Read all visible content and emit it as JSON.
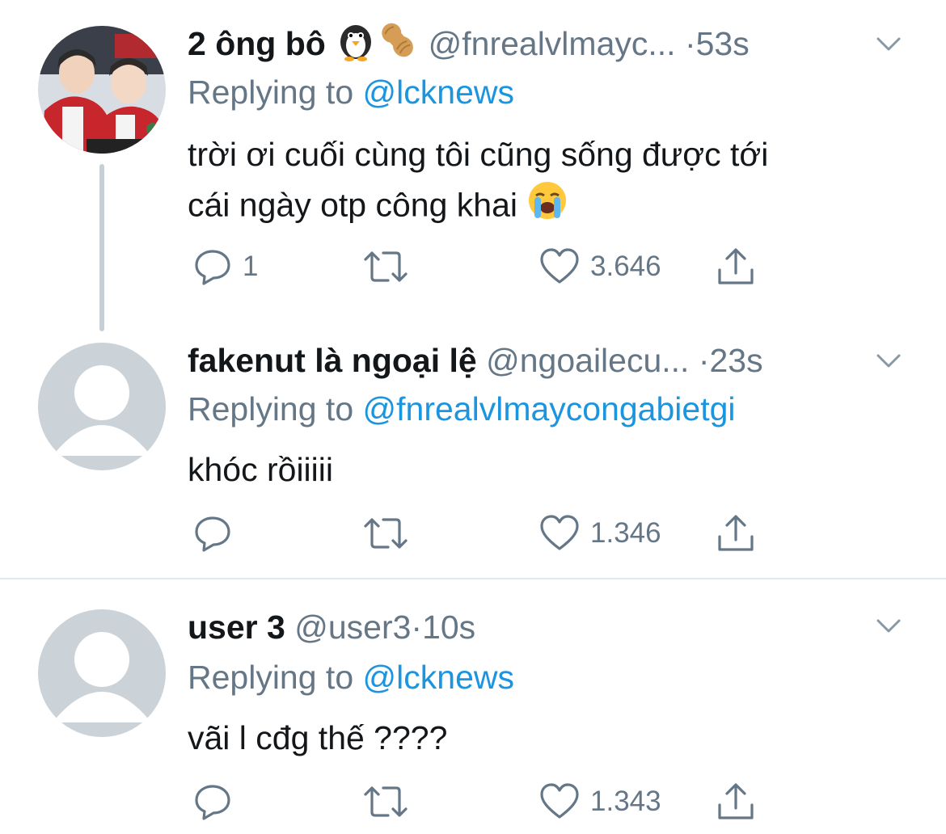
{
  "tweets": [
    {
      "name": "2 ông bô",
      "emojis": [
        "penguin-emoji",
        "peanut-emoji"
      ],
      "handle": "@fnrealvlmayc...",
      "time": "53s",
      "replying_label": "Replying to",
      "replying_handle": "@lcknews",
      "text_lines": [
        "trời ơi cuối cùng tôi cũng sống được tới",
        "cái ngày otp công khai"
      ],
      "text_emoji": "loudly-crying-face-emoji",
      "actions": {
        "reply_count": "1",
        "retweet_count": "",
        "like_count": "3.646"
      },
      "avatar": "photo"
    },
    {
      "name": "fakenut là ngoại lệ",
      "handle": "@ngoailecu...",
      "time": "23s",
      "replying_label": "Replying to",
      "replying_handle": "@fnrealvlmaycongabietgi",
      "text_lines": [
        "khóc rồiiiii"
      ],
      "actions": {
        "reply_count": "",
        "retweet_count": "",
        "like_count": "1.346"
      },
      "avatar": "default"
    },
    {
      "name": "user 3",
      "handle": "@user3",
      "time": "10s",
      "replying_label": "Replying to",
      "replying_handle": "@lcknews",
      "text_lines": [
        "vãi l cđg thế ????"
      ],
      "actions": {
        "reply_count": "",
        "retweet_count": "",
        "like_count": "1.343"
      },
      "avatar": "default"
    }
  ],
  "colors": {
    "name": "#14171a",
    "meta": "#657786",
    "link": "#1b95e0",
    "divider": "#e1e8ed",
    "thread_line": "#c4cfd6",
    "avatar_default_bg": "#cbd3d9"
  },
  "separator": "·"
}
